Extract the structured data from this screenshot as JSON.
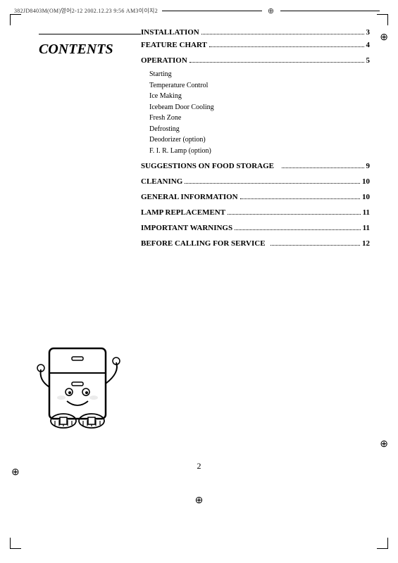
{
  "header": {
    "file_info": "382JD8403M(OM)영어2-12 2002.12.23 9:56 AM3이이지2"
  },
  "contents": {
    "title": "CONTENTS"
  },
  "toc": {
    "entries": [
      {
        "label": "INSTALLATION",
        "dots": true,
        "page": "3"
      },
      {
        "label": "FEATURE CHART",
        "dots": true,
        "page": "4"
      },
      {
        "label": "OPERATION",
        "dots": true,
        "page": "5"
      },
      {
        "label": "SUGGESTIONS ON FOOD STORAGE",
        "dots": true,
        "page": "9"
      },
      {
        "label": "CLEANING",
        "dots": true,
        "page": "10"
      },
      {
        "label": "GENERAL INFORMATION",
        "dots": true,
        "page": "10"
      },
      {
        "label": "LAMP REPLACEMENT",
        "dots": true,
        "page": "11"
      },
      {
        "label": "IMPORTANT WARNINGS",
        "dots": true,
        "page": "11"
      },
      {
        "label": "BEFORE CALLING FOR SERVICE",
        "dots": true,
        "page": "12"
      }
    ],
    "sub_items": [
      "Starting",
      "Temperature Control",
      "Ice Making",
      "Icebeam Door Cooling",
      "Fresh Zone",
      "Defrosting",
      "Deodorizer (option)",
      "F. I. R. Lamp (option)"
    ]
  },
  "page_number": "2"
}
